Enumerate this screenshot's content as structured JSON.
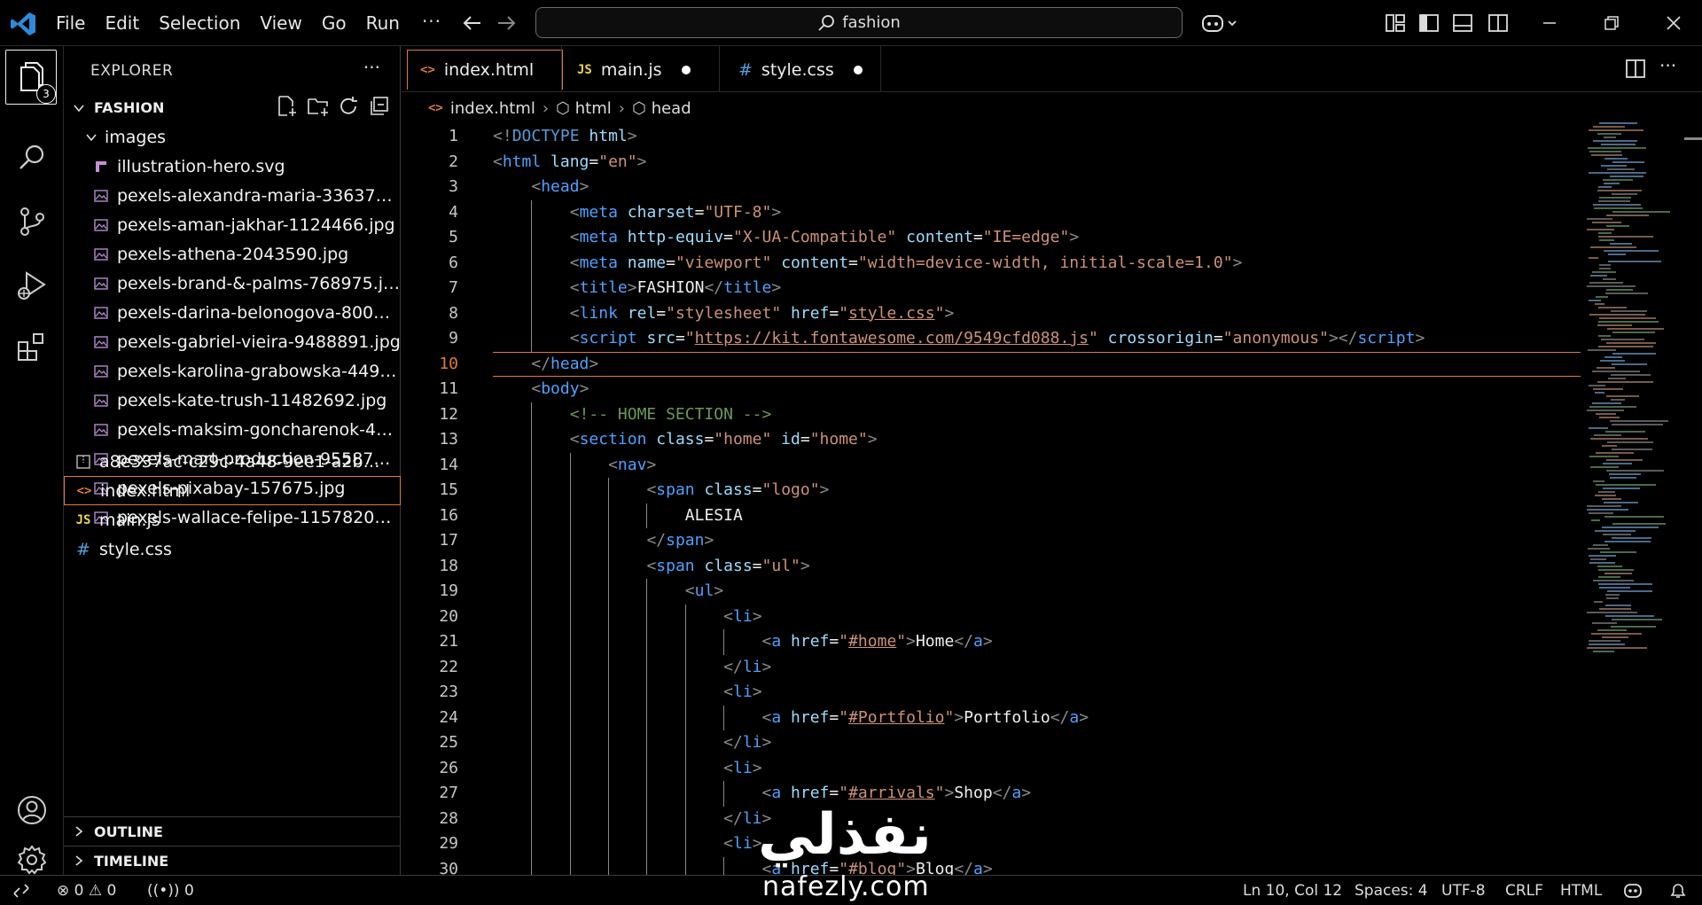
{
  "menu": [
    "File",
    "Edit",
    "Selection",
    "View",
    "Go",
    "Run"
  ],
  "search": {
    "text": "fashion"
  },
  "activity": {
    "badge": "3"
  },
  "explorer": {
    "header": "EXPLORER",
    "folder": "FASHION",
    "subfolder": "images",
    "images": [
      "illustration-hero.svg",
      "pexels-alexandra-maria-336372.jpg",
      "pexels-aman-jakhar-1124466.jpg",
      "pexels-athena-2043590.jpg",
      "pexels-brand-&-palms-768975.jpg",
      "pexels-darina-belonogova-800399...",
      "pexels-gabriel-vieira-9488891.jpg",
      "pexels-karolina-grabowska-449848...",
      "pexels-kate-trush-11482692.jpg",
      "pexels-maksim-goncharenok-4421...",
      "pexels-mart-production-9558712.j...",
      "pexels-pixabay-157675.jpg",
      "pexels-wallace-felipe-11578208.jpg"
    ],
    "zip": "a8e337ac-c29c-4a48-9ee1-a2bad17...",
    "files": [
      "index.html",
      "main.js",
      "style.css"
    ],
    "outline": "OUTLINE",
    "timeline": "TIMELINE"
  },
  "tabs": [
    {
      "label": "index.html",
      "icon": "html-icon"
    },
    {
      "label": "main.js",
      "icon": "js-icon"
    },
    {
      "label": "style.css",
      "icon": "css-icon"
    }
  ],
  "breadcrumb": [
    "index.html",
    "html",
    "head"
  ],
  "status": {
    "errors": "0",
    "warnings": "0",
    "ports": "0",
    "position": "Ln 10, Col 12",
    "spaces": "Spaces: 4",
    "encoding": "UTF-8",
    "eol": "CRLF",
    "language": "HTML"
  },
  "watermark": {
    "arabic": "نفذلي",
    "latin": "nafezly.com"
  },
  "code": [
    {
      "n": "1",
      "t": [
        [
          "p",
          "<!"
        ],
        [
          "kw",
          "DOCTYPE"
        ],
        [
          "x",
          " "
        ],
        [
          "at",
          "html"
        ],
        [
          "p",
          ">"
        ]
      ]
    },
    {
      "n": "2",
      "t": [
        [
          "p",
          "<"
        ],
        [
          "tg",
          "html"
        ],
        [
          "x",
          " "
        ],
        [
          "at",
          "lang"
        ],
        [
          "x",
          "="
        ],
        [
          "st",
          "\"en\""
        ],
        [
          "p",
          ">"
        ]
      ]
    },
    {
      "n": "3",
      "t": [
        [
          "p",
          "<"
        ],
        [
          "tg",
          "head"
        ],
        [
          "p",
          ">"
        ]
      ]
    },
    {
      "n": "4",
      "t": [
        [
          "p",
          "<"
        ],
        [
          "tg",
          "meta"
        ],
        [
          "x",
          " "
        ],
        [
          "at",
          "charset"
        ],
        [
          "x",
          "="
        ],
        [
          "st",
          "\"UTF-8\""
        ],
        [
          "p",
          ">"
        ]
      ]
    },
    {
      "n": "5",
      "t": [
        [
          "p",
          "<"
        ],
        [
          "tg",
          "meta"
        ],
        [
          "x",
          " "
        ],
        [
          "at",
          "http-equiv"
        ],
        [
          "x",
          "="
        ],
        [
          "st",
          "\"X-UA-Compatible\""
        ],
        [
          "x",
          " "
        ],
        [
          "at",
          "content"
        ],
        [
          "x",
          "="
        ],
        [
          "st",
          "\"IE=edge\""
        ],
        [
          "p",
          ">"
        ]
      ]
    },
    {
      "n": "6",
      "t": [
        [
          "p",
          "<"
        ],
        [
          "tg",
          "meta"
        ],
        [
          "x",
          " "
        ],
        [
          "at",
          "name"
        ],
        [
          "x",
          "="
        ],
        [
          "st",
          "\"viewport\""
        ],
        [
          "x",
          " "
        ],
        [
          "at",
          "content"
        ],
        [
          "x",
          "="
        ],
        [
          "st",
          "\"width=device-width, initial-scale=1.0\""
        ],
        [
          "p",
          ">"
        ]
      ]
    },
    {
      "n": "7",
      "t": [
        [
          "p",
          "<"
        ],
        [
          "tg",
          "title"
        ],
        [
          "p",
          ">"
        ],
        [
          "x",
          "FASHION"
        ],
        [
          "p",
          "</"
        ],
        [
          "tg",
          "title"
        ],
        [
          "p",
          ">"
        ]
      ]
    },
    {
      "n": "8",
      "t": [
        [
          "p",
          "<"
        ],
        [
          "tg",
          "link"
        ],
        [
          "x",
          " "
        ],
        [
          "at",
          "rel"
        ],
        [
          "x",
          "="
        ],
        [
          "st",
          "\"stylesheet\""
        ],
        [
          "x",
          " "
        ],
        [
          "at",
          "href"
        ],
        [
          "x",
          "="
        ],
        [
          "st",
          "\""
        ],
        [
          "su",
          "style.css"
        ],
        [
          "st",
          "\""
        ],
        [
          "p",
          ">"
        ]
      ]
    },
    {
      "n": "9",
      "t": [
        [
          "p",
          "<"
        ],
        [
          "tg",
          "script"
        ],
        [
          "x",
          " "
        ],
        [
          "at",
          "src"
        ],
        [
          "x",
          "="
        ],
        [
          "st",
          "\""
        ],
        [
          "su",
          "https://kit.fontawesome.com/9549cfd088.js"
        ],
        [
          "st",
          "\""
        ],
        [
          "x",
          " "
        ],
        [
          "at",
          "crossorigin"
        ],
        [
          "x",
          "="
        ],
        [
          "st",
          "\"anonymous\""
        ],
        [
          "p",
          "></"
        ],
        [
          "tg",
          "script"
        ],
        [
          "p",
          ">"
        ]
      ]
    },
    {
      "n": "10",
      "t": [
        [
          "p",
          "</"
        ],
        [
          "tg",
          "head"
        ],
        [
          "p",
          ">"
        ]
      ]
    },
    {
      "n": "11",
      "t": [
        [
          "p",
          "<"
        ],
        [
          "tg",
          "body"
        ],
        [
          "p",
          ">"
        ]
      ]
    },
    {
      "n": "12",
      "t": [
        [
          "cm",
          "<!-- HOME SECTION -->"
        ]
      ]
    },
    {
      "n": "13",
      "t": [
        [
          "p",
          "<"
        ],
        [
          "tg",
          "section"
        ],
        [
          "x",
          " "
        ],
        [
          "at",
          "class"
        ],
        [
          "x",
          "="
        ],
        [
          "st",
          "\"home\""
        ],
        [
          "x",
          " "
        ],
        [
          "at",
          "id"
        ],
        [
          "x",
          "="
        ],
        [
          "st",
          "\"home\""
        ],
        [
          "p",
          ">"
        ]
      ]
    },
    {
      "n": "14",
      "t": [
        [
          "p",
          "<"
        ],
        [
          "tg",
          "nav"
        ],
        [
          "p",
          ">"
        ]
      ]
    },
    {
      "n": "15",
      "t": [
        [
          "p",
          "<"
        ],
        [
          "tg",
          "span"
        ],
        [
          "x",
          " "
        ],
        [
          "at",
          "class"
        ],
        [
          "x",
          "="
        ],
        [
          "st",
          "\"logo\""
        ],
        [
          "p",
          ">"
        ]
      ]
    },
    {
      "n": "16",
      "t": [
        [
          "x",
          "ALESIA"
        ]
      ]
    },
    {
      "n": "17",
      "t": [
        [
          "p",
          "</"
        ],
        [
          "tg",
          "span"
        ],
        [
          "p",
          ">"
        ]
      ]
    },
    {
      "n": "18",
      "t": [
        [
          "p",
          "<"
        ],
        [
          "tg",
          "span"
        ],
        [
          "x",
          " "
        ],
        [
          "at",
          "class"
        ],
        [
          "x",
          "="
        ],
        [
          "st",
          "\"ul\""
        ],
        [
          "p",
          ">"
        ]
      ]
    },
    {
      "n": "19",
      "t": [
        [
          "p",
          "<"
        ],
        [
          "tg",
          "ul"
        ],
        [
          "p",
          ">"
        ]
      ]
    },
    {
      "n": "20",
      "t": [
        [
          "p",
          "<"
        ],
        [
          "tg",
          "li"
        ],
        [
          "p",
          ">"
        ]
      ]
    },
    {
      "n": "21",
      "t": [
        [
          "p",
          "<"
        ],
        [
          "tg",
          "a"
        ],
        [
          "x",
          " "
        ],
        [
          "at",
          "href"
        ],
        [
          "x",
          "="
        ],
        [
          "st",
          "\""
        ],
        [
          "su",
          "#home"
        ],
        [
          "st",
          "\""
        ],
        [
          "p",
          ">"
        ],
        [
          "x",
          "Home"
        ],
        [
          "p",
          "</"
        ],
        [
          "tg",
          "a"
        ],
        [
          "p",
          ">"
        ]
      ]
    },
    {
      "n": "22",
      "t": [
        [
          "p",
          "</"
        ],
        [
          "tg",
          "li"
        ],
        [
          "p",
          ">"
        ]
      ]
    },
    {
      "n": "23",
      "t": [
        [
          "p",
          "<"
        ],
        [
          "tg",
          "li"
        ],
        [
          "p",
          ">"
        ]
      ]
    },
    {
      "n": "24",
      "t": [
        [
          "p",
          "<"
        ],
        [
          "tg",
          "a"
        ],
        [
          "x",
          " "
        ],
        [
          "at",
          "href"
        ],
        [
          "x",
          "="
        ],
        [
          "st",
          "\""
        ],
        [
          "su",
          "#Portfolio"
        ],
        [
          "st",
          "\""
        ],
        [
          "p",
          ">"
        ],
        [
          "x",
          "Portfolio"
        ],
        [
          "p",
          "</"
        ],
        [
          "tg",
          "a"
        ],
        [
          "p",
          ">"
        ]
      ]
    },
    {
      "n": "25",
      "t": [
        [
          "p",
          "</"
        ],
        [
          "tg",
          "li"
        ],
        [
          "p",
          ">"
        ]
      ]
    },
    {
      "n": "26",
      "t": [
        [
          "p",
          "<"
        ],
        [
          "tg",
          "li"
        ],
        [
          "p",
          ">"
        ]
      ]
    },
    {
      "n": "27",
      "t": [
        [
          "p",
          "<"
        ],
        [
          "tg",
          "a"
        ],
        [
          "x",
          " "
        ],
        [
          "at",
          "href"
        ],
        [
          "x",
          "="
        ],
        [
          "st",
          "\""
        ],
        [
          "su",
          "#arrivals"
        ],
        [
          "st",
          "\""
        ],
        [
          "p",
          ">"
        ],
        [
          "x",
          "Shop"
        ],
        [
          "p",
          "</"
        ],
        [
          "tg",
          "a"
        ],
        [
          "p",
          ">"
        ]
      ]
    },
    {
      "n": "28",
      "t": [
        [
          "p",
          "</"
        ],
        [
          "tg",
          "li"
        ],
        [
          "p",
          ">"
        ]
      ]
    },
    {
      "n": "29",
      "t": [
        [
          "p",
          "<"
        ],
        [
          "tg",
          "li"
        ],
        [
          "p",
          ">"
        ]
      ]
    },
    {
      "n": "30",
      "t": [
        [
          "p",
          "<"
        ],
        [
          "tg",
          "a"
        ],
        [
          "x",
          " "
        ],
        [
          "at",
          "href"
        ],
        [
          "x",
          "="
        ],
        [
          "st",
          "\""
        ],
        [
          "su",
          "#blog"
        ],
        [
          "st",
          "\""
        ],
        [
          "p",
          ">"
        ],
        [
          "x",
          "Blog"
        ],
        [
          "p",
          "</"
        ],
        [
          "tg",
          "a"
        ],
        [
          "p",
          ">"
        ]
      ]
    }
  ],
  "colors": {
    "accent": "#e07a3b",
    "tag": "#4ea1ff",
    "attr": "#9cdcfe",
    "string": "#ce9178",
    "comment": "#6a9955"
  }
}
